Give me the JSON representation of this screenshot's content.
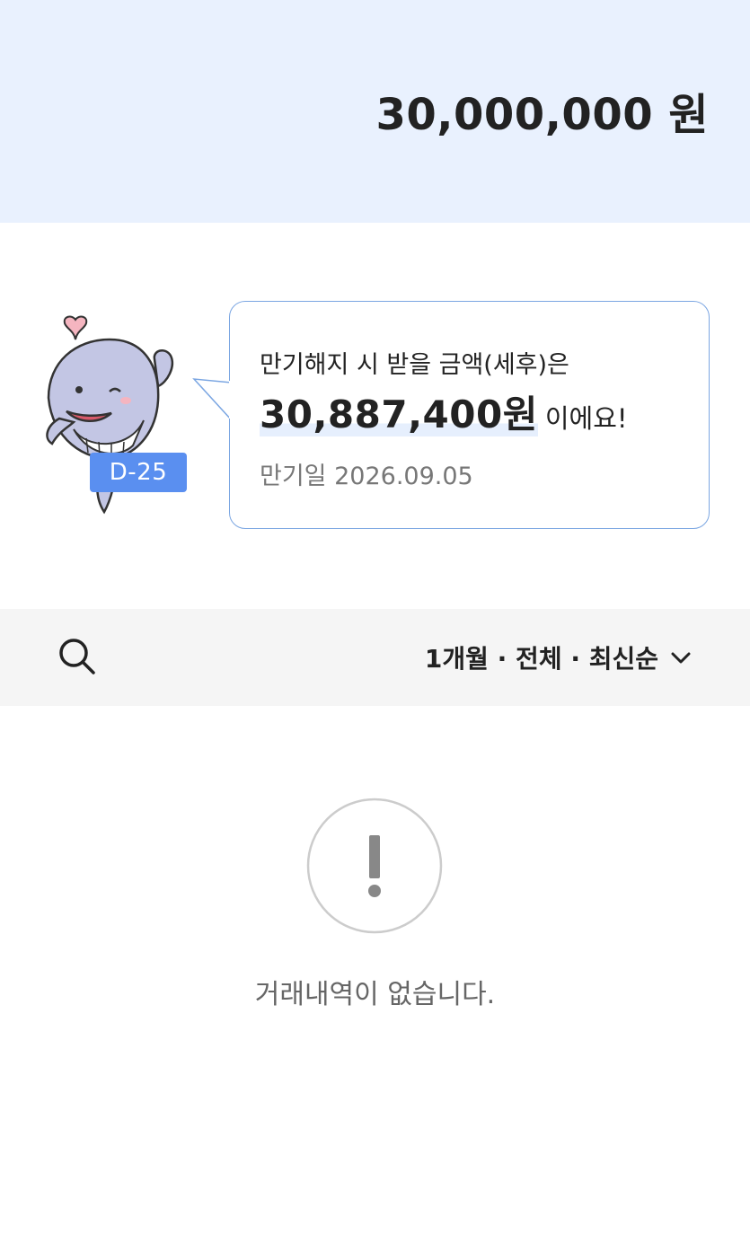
{
  "header": {
    "balance": "30,000,000 원"
  },
  "mascot": {
    "dday_badge": "D-25"
  },
  "bubble": {
    "line1": "만기해지 시 받을 금액(세후)은",
    "payout_amount": "30,887,400원",
    "payout_suffix": "이에요!",
    "maturity_date": "만기일 2026.09.05"
  },
  "filter_bar": {
    "filter_label": "1개월 · 전체 · 최신순",
    "search_icon": "search-icon",
    "dropdown_icon": "chevron-down-icon"
  },
  "empty_state": {
    "icon": "exclamation-icon",
    "message": "거래내역이 없습니다."
  },
  "colors": {
    "banner_bg": "#e9f1fe",
    "accent_blue": "#5a8ff0",
    "bubble_border": "#7ba6e2",
    "filter_bg": "#f5f5f5"
  }
}
